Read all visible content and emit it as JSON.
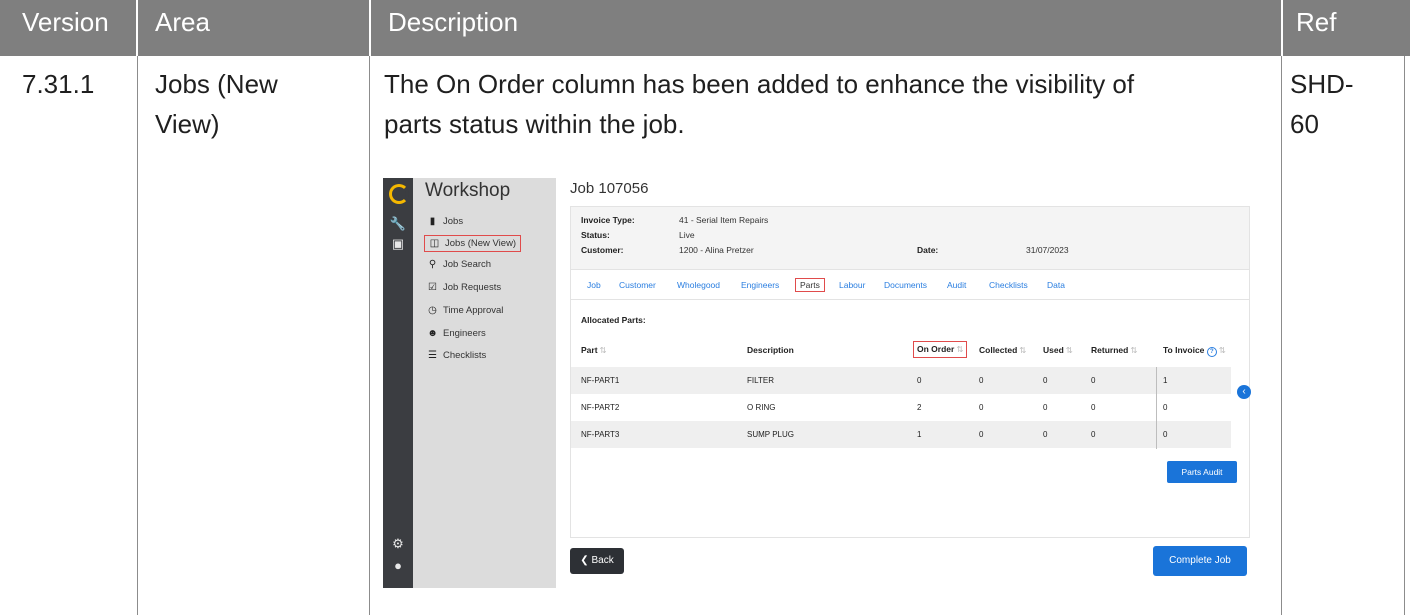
{
  "table": {
    "headers": {
      "version": "Version",
      "area": "Area",
      "description": "Description",
      "ref": "Ref"
    },
    "row": {
      "version": "7.31.1",
      "area_line1": "Jobs (New",
      "area_line2": "View)",
      "description_line1": "The On Order column has been added to enhance the visibility of",
      "description_line2": "parts status within the job.",
      "ref_line1": "SHD-",
      "ref_line2": "60"
    }
  },
  "screenshot": {
    "brand": "Workshop",
    "nav": [
      {
        "label": "Jobs",
        "icon": "clipboard-icon"
      },
      {
        "label": "Jobs (New View)",
        "icon": "board-icon",
        "highlighted": true
      },
      {
        "label": "Job Search",
        "icon": "search-icon"
      },
      {
        "label": "Job Requests",
        "icon": "check-clipboard-icon"
      },
      {
        "label": "Time Approval",
        "icon": "clock-icon"
      },
      {
        "label": "Engineers",
        "icon": "users-icon"
      },
      {
        "label": "Checklists",
        "icon": "checklist-icon"
      }
    ],
    "job_title": "Job 107056",
    "info": {
      "invoice_type_label": "Invoice Type:",
      "invoice_type_value": "41 - Serial Item Repairs",
      "status_label": "Status:",
      "status_value": "Live",
      "customer_label": "Customer:",
      "customer_value": "1200 - Alina Pretzer",
      "date_label": "Date:",
      "date_value": "31/07/2023"
    },
    "tabs": [
      "Job",
      "Customer",
      "Wholegood",
      "Engineers",
      "Parts",
      "Labour",
      "Documents",
      "Audit",
      "Checklists",
      "Data"
    ],
    "selected_tab": "Parts",
    "allocated_label": "Allocated Parts:",
    "columns": [
      "Part",
      "Description",
      "On Order",
      "Collected",
      "Used",
      "Returned",
      "To Invoice"
    ],
    "rows": [
      [
        "NF-PART1",
        "FILTER",
        "0",
        "0",
        "0",
        "0",
        "1"
      ],
      [
        "NF-PART2",
        "O RING",
        "2",
        "0",
        "0",
        "0",
        "0"
      ],
      [
        "NF-PART3",
        "SUMP PLUG",
        "1",
        "0",
        "0",
        "0",
        "0"
      ]
    ],
    "parts_audit_label": "Parts Audit",
    "back_label": "Back",
    "complete_label": "Complete Job",
    "accent": "#1a74d9",
    "highlight": "#e04b4b"
  }
}
